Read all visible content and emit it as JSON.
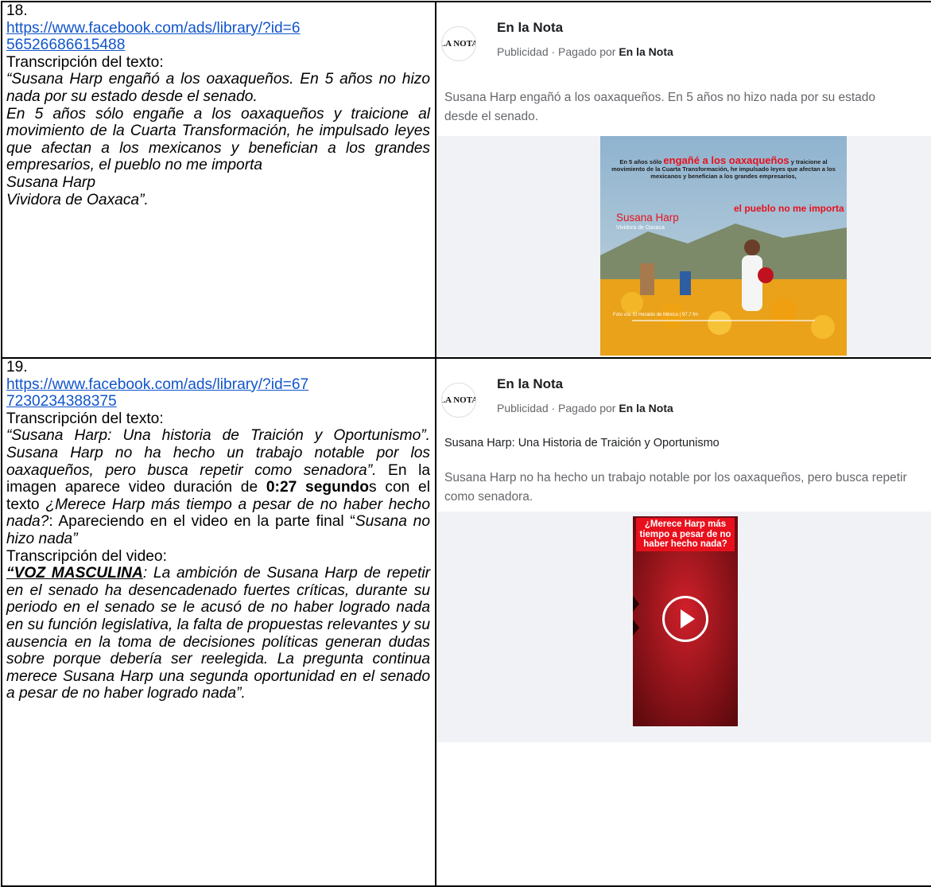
{
  "entries": [
    {
      "number": "18.",
      "url": "https://www.facebook.com/ads/library/?id=656526686615488",
      "url_line1": "https://www.facebook.com/ads/library/?id=6",
      "url_line2": "56526686615488",
      "transcription_label": "Transcripción del texto:",
      "quote_lines": [
        "“Susana Harp engañó a los oaxaqueños. En 5 años no hizo nada por su estado desde el senado.",
        "En 5 años sólo engañe a los oaxaqueños y traicione al movimiento de la Cuarta Transformación, he impulsado leyes que afectan a los mexicanos y benefician a los grandes empresarios, el pueblo no me importa",
        "Susana Harp",
        "Vividora de Oaxaca”."
      ],
      "ad": {
        "page_name": "En la Nota",
        "logo_text": "LA NOTA",
        "sponsored": "Publicidad · Pagado por",
        "sponsor_name": "En la Nota",
        "body": "Susana Harp engañó a los oaxaqueños. En 5 años no hizo nada por su estado",
        "body_line2": "desde el senado.",
        "image": {
          "caption_lead": "En 5 años sólo",
          "caption_highlight": "engañé a los oaxaqueños",
          "caption_rest": "y traicione al movimiento de la Cuarta Transformación, he impulsado leyes que afectan a los mexicanos y benefician a los grandes empresarios,",
          "caption_red": "el pueblo no me importa",
          "name": "Susana Harp",
          "subtitle": "Vividora de Oaxaca",
          "credit": "Foto vía: El Heraldo de México | 97.7 fm"
        }
      }
    },
    {
      "number": "19.",
      "url_line1": "https://www.facebook.com/ads/library/?id=67",
      "url_line2": "7230234388375",
      "transcription_label": "Transcripción del texto:",
      "quote": "“Susana Harp: Una historia  de Traición y Oportunismo”. Susana Harp no ha hecho un trabajo notable por los oaxaqueños, pero busca repetir como senadora”.",
      "image_desc_1": " En la imagen aparece video duración de ",
      "duration": "0:27 segundo",
      "image_desc_2": "s con el texto ",
      "video_question": "¿Merece Harp más tiempo a pesar de no haber hecho nada?",
      "image_desc_3": ": Apareciendo en el video en la parte final “",
      "video_final": "Susana no hizo nada”",
      "video_label": "Transcripción del video:",
      "speaker": "“VOZ MASCULINA",
      "video_transcript": ": La ambición de Susana Harp de repetir en el senado ha desencadenado fuertes críticas, durante su periodo en el senado se le acusó de no haber logrado nada en su función legislativa, la falta de propuestas relevantes y su ausencia en la toma de decisiones políticas generan dudas sobre porque debería ser reelegida. La pregunta continua merece Susana Harp una segunda oportunidad en el senado a pesar de no haber logrado nada”.",
      "ad": {
        "page_name": "En la Nota",
        "logo_text": "LA NOTA",
        "sponsored": "Publicidad · Pagado por",
        "sponsor_name": "En la Nota",
        "headline": "Susana Harp: Una Historia de Traición y Oportunismo",
        "body": "Susana Harp no ha hecho un trabajo notable por los oaxaqueños, pero busca repetir",
        "body_line2": "como senadora.",
        "video_text": "¿Merece Harp más tiempo a pesar de no haber hecho nada?"
      }
    }
  ],
  "colors": {
    "link": "#1155cc",
    "ad_grey": "#65676b",
    "poster_red": "#e8101d",
    "video_red": "#b3141c"
  }
}
